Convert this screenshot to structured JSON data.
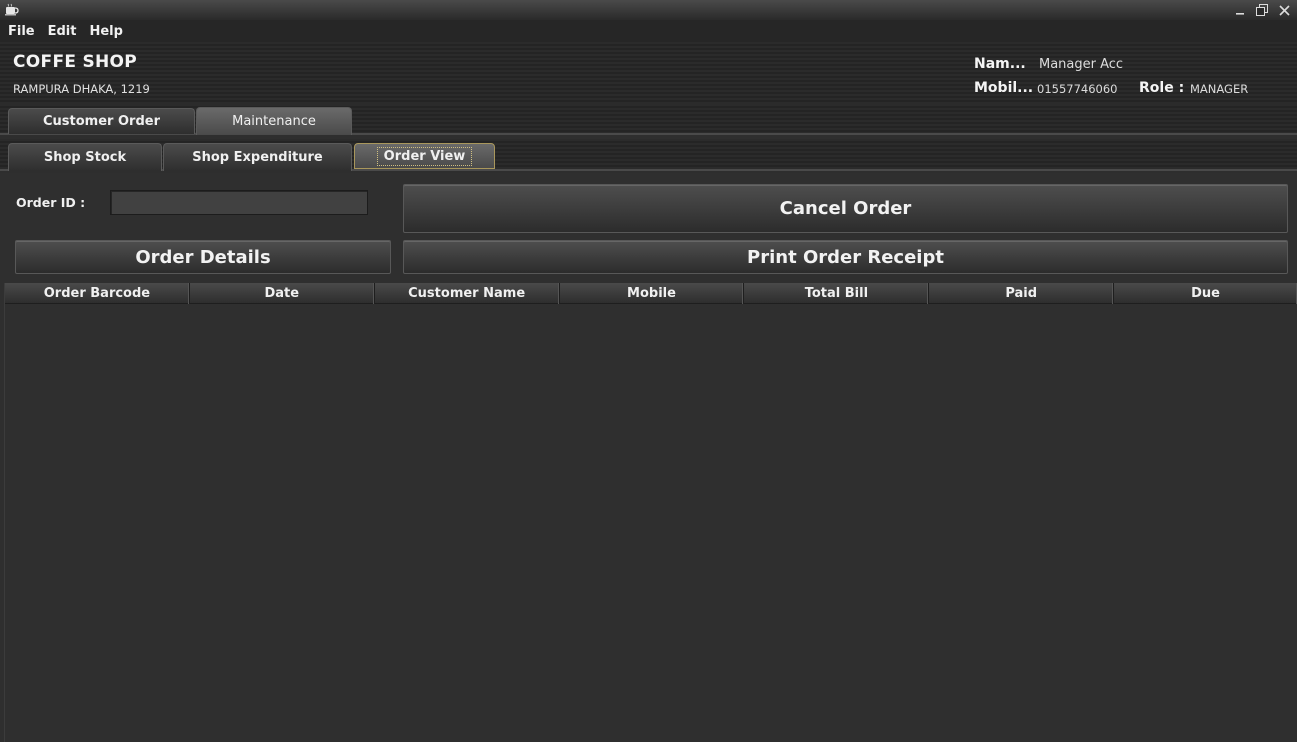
{
  "window": {
    "app_icon": "coffee-cup-icon",
    "controls": [
      "minimize-icon",
      "maximize-icon",
      "close-icon"
    ]
  },
  "menu": [
    "File",
    "Edit",
    "Help"
  ],
  "header": {
    "shop_name": "COFFE SHOP",
    "address": "RAMPURA DHAKA, 1219",
    "name_label": "Nam...",
    "name_value": "Manager Acc",
    "mobile_label": "Mobil...",
    "mobile_value": "01557746060",
    "role_label": "Role :",
    "role_value": "MANAGER"
  },
  "main_tabs": [
    {
      "label": "Customer Order",
      "selected": false
    },
    {
      "label": "Maintenance",
      "selected": true
    }
  ],
  "sub_tabs": [
    {
      "label": "Shop Stock",
      "selected": false
    },
    {
      "label": "Shop Expenditure",
      "selected": false
    },
    {
      "label": "Order View",
      "selected": true
    }
  ],
  "order_view": {
    "order_id_label": "Order ID :",
    "order_id_value": "",
    "cancel_label": "Cancel Order",
    "details_label": "Order Details",
    "print_label": "Print Order Receipt",
    "columns": [
      "Order Barcode",
      "Date",
      "Customer Name",
      "Mobile",
      "Total Bill",
      "Paid",
      "Due"
    ],
    "rows": []
  }
}
